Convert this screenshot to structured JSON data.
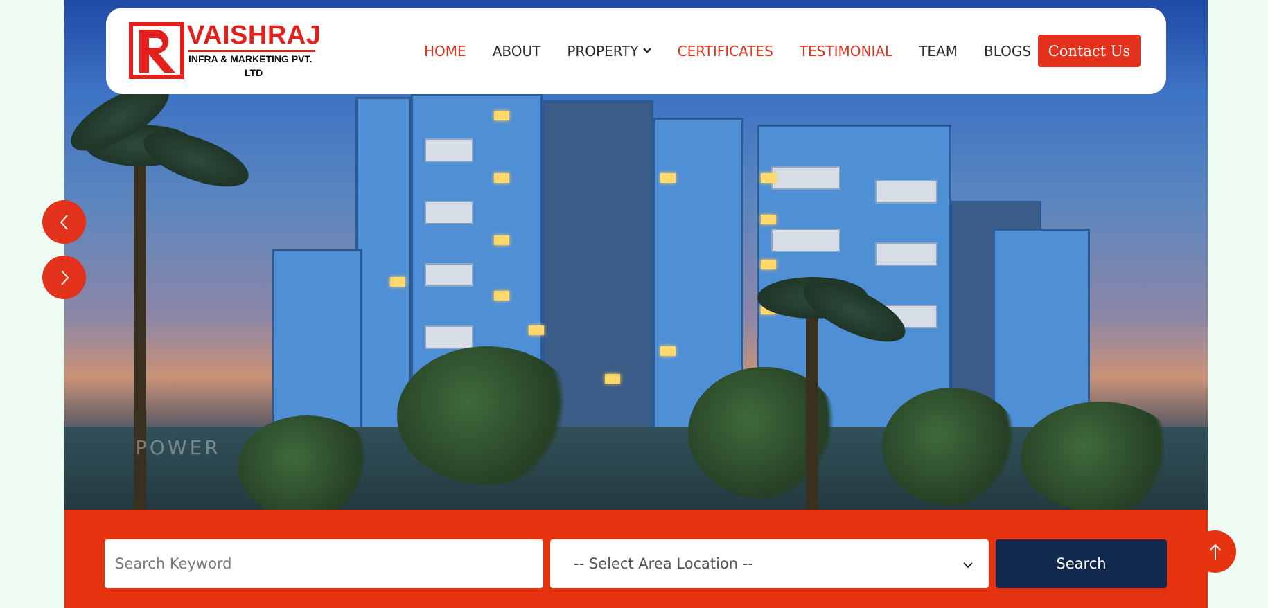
{
  "brand": {
    "name": "VAISHRAJ",
    "subtitle_line1": "INFRA & MARKETING PVT.",
    "subtitle_line2": "LTD",
    "accent_color": "#e3321c",
    "dark_color": "#12284f"
  },
  "nav": {
    "items": [
      {
        "label": "HOME",
        "active": true
      },
      {
        "label": "ABOUT",
        "active": false
      },
      {
        "label": "PROPERTY",
        "active": false,
        "has_dropdown": true
      },
      {
        "label": "CERTIFICATES",
        "active": true
      },
      {
        "label": "TESTIMONIAL",
        "active": true
      },
      {
        "label": "TEAM",
        "active": false
      },
      {
        "label": "BLOGS",
        "active": false
      }
    ],
    "contact_label": "Contact Us"
  },
  "hero": {
    "watermark": "POWER",
    "prev_icon": "chevron-left-icon",
    "next_icon": "chevron-right-icon"
  },
  "search": {
    "keyword_placeholder": "Search Keyword",
    "keyword_value": "",
    "area_selected": "-- Select Area Location --",
    "button_label": "Search"
  },
  "scroll_top_icon": "arrow-up-icon"
}
